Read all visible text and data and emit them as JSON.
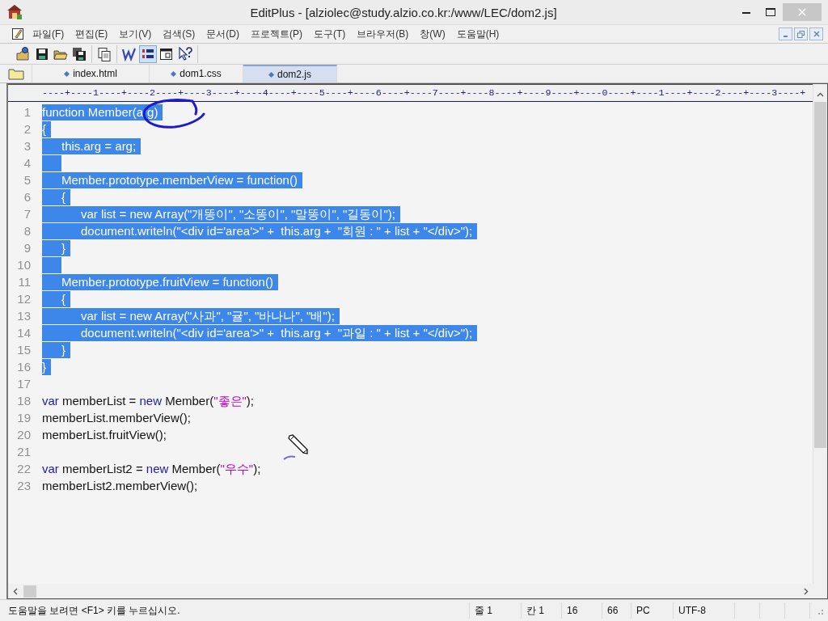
{
  "window": {
    "title": "EditPlus - [alziolec@study.alzio.co.kr:/www/LEC/dom2.js]"
  },
  "menu": [
    {
      "label": "파일(F)"
    },
    {
      "label": "편집(E)"
    },
    {
      "label": "보기(V)"
    },
    {
      "label": "검색(S)"
    },
    {
      "label": "문서(D)"
    },
    {
      "label": "프로젝트(P)"
    },
    {
      "label": "도구(T)"
    },
    {
      "label": "브라우저(B)"
    },
    {
      "label": "창(W)"
    },
    {
      "label": "도움말(H)"
    }
  ],
  "toolbar": {
    "groups": [
      {
        "buttons": [
          {
            "kind": "remote-open",
            "selected": false
          },
          {
            "kind": "save",
            "selected": false
          },
          {
            "kind": "open",
            "selected": false
          },
          {
            "kind": "save-all",
            "selected": false
          }
        ]
      },
      {
        "buttons": [
          {
            "kind": "pages",
            "selected": false
          }
        ]
      },
      {
        "buttons": [
          {
            "kind": "spell",
            "selected": false
          },
          {
            "kind": "line-numbers",
            "selected": true
          },
          {
            "kind": "window",
            "selected": false
          },
          {
            "kind": "help",
            "selected": false
          }
        ]
      }
    ]
  },
  "tabs": [
    {
      "label": "index.html",
      "selected": false
    },
    {
      "label": "dom1.css",
      "selected": false
    },
    {
      "label": "dom2.js",
      "selected": true
    }
  ],
  "ruler": "----+----1----+----2----+----3----+----4----+----5----+----6----+----7----+----8----+----9----+----0----+----1----+----2----+----3----+",
  "editor": {
    "lines": [
      {
        "number": "1",
        "selected": true,
        "tokens": [
          {
            "kind": "plain",
            "text": "function Member(arg)"
          }
        ]
      },
      {
        "number": "2",
        "selected": true,
        "tokens": [
          {
            "kind": "plain",
            "text": "{"
          }
        ]
      },
      {
        "number": "3",
        "selected": true,
        "tokens": [
          {
            "kind": "plain",
            "text": "\tthis.arg = arg;"
          }
        ]
      },
      {
        "number": "4",
        "selected": true
      },
      {
        "number": "5",
        "selected": true,
        "tokens": [
          {
            "kind": "plain",
            "text": "\tMember.prototype.memberView = function()"
          }
        ]
      },
      {
        "number": "6",
        "selected": true,
        "tokens": [
          {
            "kind": "plain",
            "text": "\t{"
          }
        ]
      },
      {
        "number": "7",
        "selected": true,
        "tokens": [
          {
            "kind": "plain",
            "text": "\t\tvar list = new Array(\"개똥이\", \"소똥이\", \"말똥이\", \"길동이\");"
          }
        ]
      },
      {
        "number": "8",
        "selected": true,
        "tokens": [
          {
            "kind": "plain",
            "text": "\t\tdocument.writeln(\"<div id='area'>\" +  this.arg +  \"회원 : \" + list + \"</div>\");"
          }
        ]
      },
      {
        "number": "9",
        "selected": true,
        "tokens": [
          {
            "kind": "plain",
            "text": "\t}"
          }
        ]
      },
      {
        "number": "10",
        "selected": true
      },
      {
        "number": "11",
        "selected": true,
        "tokens": [
          {
            "kind": "plain",
            "text": "\tMember.prototype.fruitView = function()"
          }
        ]
      },
      {
        "number": "12",
        "selected": true,
        "tokens": [
          {
            "kind": "plain",
            "text": "\t{"
          }
        ]
      },
      {
        "number": "13",
        "selected": true,
        "tokens": [
          {
            "kind": "plain",
            "text": "\t\tvar list = new Array(\"사과\", \"귤\", \"바나나\", \"배\");"
          }
        ]
      },
      {
        "number": "14",
        "selected": true,
        "tokens": [
          {
            "kind": "plain",
            "text": "\t\tdocument.writeln(\"<div id='area'>\" +  this.arg +  \"과일 : \" + list + \"</div>\");"
          }
        ]
      },
      {
        "number": "15",
        "selected": true,
        "tokens": [
          {
            "kind": "plain",
            "text": "\t}"
          }
        ]
      },
      {
        "number": "16",
        "selected": true,
        "tokens": [
          {
            "kind": "plain",
            "text": "}"
          }
        ]
      },
      {
        "number": "17",
        "selected": false
      },
      {
        "number": "18",
        "selected": false,
        "tokens": [
          {
            "kind": "keyword",
            "text": "var"
          },
          {
            "kind": "plain",
            "text": " memberList = "
          },
          {
            "kind": "keyword",
            "text": "new"
          },
          {
            "kind": "plain",
            "text": " Member("
          },
          {
            "kind": "string",
            "text": "\"좋은\""
          },
          {
            "kind": "plain",
            "text": ");"
          }
        ]
      },
      {
        "number": "19",
        "selected": false,
        "tokens": [
          {
            "kind": "plain",
            "text": "memberList.memberView();"
          }
        ]
      },
      {
        "number": "20",
        "selected": false,
        "tokens": [
          {
            "kind": "plain",
            "text": "memberList.fruitView();"
          }
        ]
      },
      {
        "number": "21",
        "selected": false
      },
      {
        "number": "22",
        "selected": false,
        "tokens": [
          {
            "kind": "keyword",
            "text": "var"
          },
          {
            "kind": "plain",
            "text": " memberList2 = "
          },
          {
            "kind": "keyword",
            "text": "new"
          },
          {
            "kind": "plain",
            "text": " Member("
          },
          {
            "kind": "string",
            "text": "\"우수\""
          },
          {
            "kind": "plain",
            "text": ");"
          }
        ]
      },
      {
        "number": "23",
        "selected": false,
        "tokens": [
          {
            "kind": "plain",
            "text": "memberList2.memberView();"
          }
        ]
      }
    ]
  },
  "status_bar": {
    "cells": [
      {
        "text": "도움말을 보려면 <F1> 키를 누르십시오."
      },
      {
        "text": "줄 1"
      },
      {
        "text": "칸 1"
      },
      {
        "text": "16"
      },
      {
        "text": "66"
      },
      {
        "text": "PC"
      },
      {
        "text": "UTF-8"
      }
    ]
  }
}
